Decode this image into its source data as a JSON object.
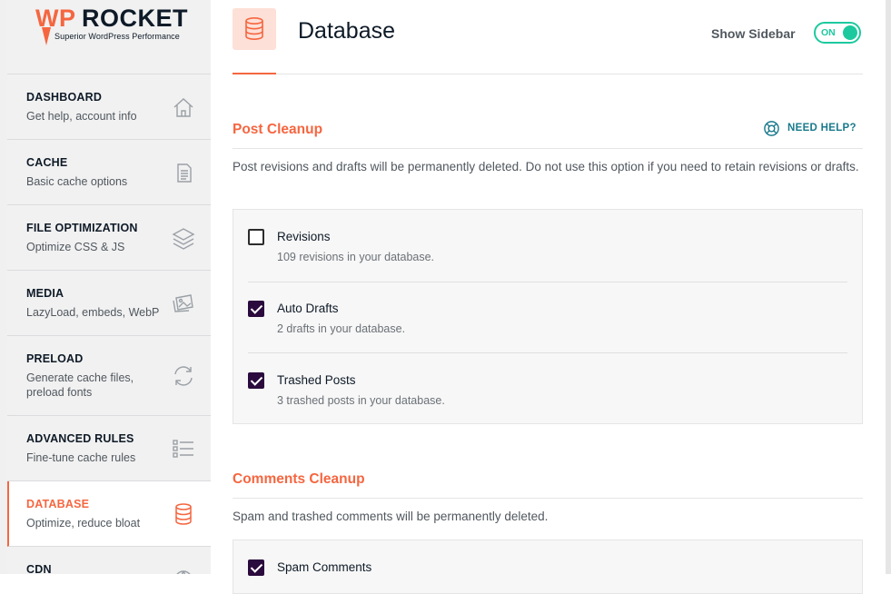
{
  "brand": {
    "logo_wp": "WP",
    "logo_rocket": "ROCKET",
    "tagline": "Superior WordPress Performance",
    "accent": "#f56640",
    "toggle_color": "#1cc99f",
    "checkbox_color": "#2b0a3d",
    "help_color": "#1a7a8c"
  },
  "sidebar": {
    "items": [
      {
        "title": "DASHBOARD",
        "subtitle": "Get help, account info",
        "icon": "home-icon"
      },
      {
        "title": "CACHE",
        "subtitle": "Basic cache options",
        "icon": "document-icon"
      },
      {
        "title": "FILE OPTIMIZATION",
        "subtitle": "Optimize CSS & JS",
        "icon": "layers-icon"
      },
      {
        "title": "MEDIA",
        "subtitle": "LazyLoad, embeds, WebP",
        "icon": "images-icon"
      },
      {
        "title": "PRELOAD",
        "subtitle": "Generate cache files, preload fonts",
        "icon": "refresh-icon"
      },
      {
        "title": "ADVANCED RULES",
        "subtitle": "Fine-tune cache rules",
        "icon": "list-icon"
      },
      {
        "title": "DATABASE",
        "subtitle": "Optimize, reduce bloat",
        "icon": "database-icon",
        "active": true
      },
      {
        "title": "CDN",
        "subtitle": "",
        "icon": "cdn-icon"
      }
    ]
  },
  "header": {
    "title": "Database",
    "show_sidebar_label": "Show Sidebar",
    "toggle_state": "ON"
  },
  "post_cleanup": {
    "title": "Post Cleanup",
    "help_label": "NEED HELP?",
    "description": "Post revisions and drafts will be permanently deleted. Do not use this option if you need to retain revisions or drafts.",
    "options": [
      {
        "label": "Revisions",
        "detail": "109 revisions in your database.",
        "checked": false
      },
      {
        "label": "Auto Drafts",
        "detail": "2 drafts in your database.",
        "checked": true
      },
      {
        "label": "Trashed Posts",
        "detail": "3 trashed posts in your database.",
        "checked": true
      }
    ]
  },
  "comments_cleanup": {
    "title": "Comments Cleanup",
    "description": "Spam and trashed comments will be permanently deleted.",
    "options": [
      {
        "label": "Spam Comments",
        "checked": true
      }
    ]
  }
}
